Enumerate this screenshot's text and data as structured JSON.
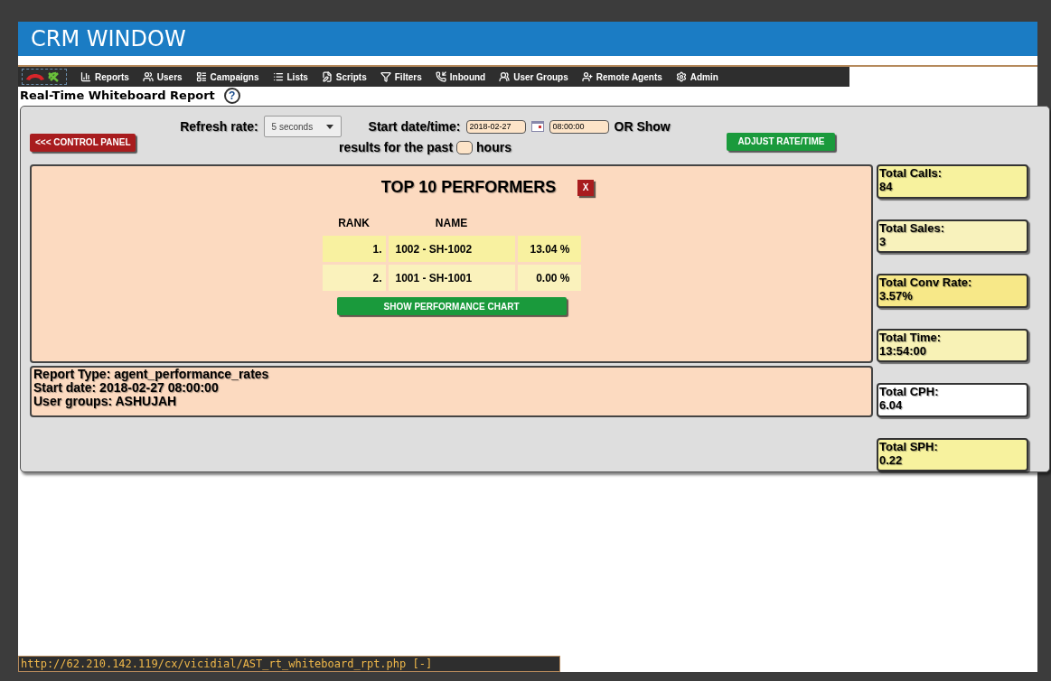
{
  "window": {
    "title": "CRM WINDOW"
  },
  "nav": [
    {
      "label": "Reports",
      "kind": "reports"
    },
    {
      "label": "Users",
      "kind": "users"
    },
    {
      "label": "Campaigns",
      "kind": "campaigns"
    },
    {
      "label": "Lists",
      "kind": "lists"
    },
    {
      "label": "Scripts",
      "kind": "scripts"
    },
    {
      "label": "Filters",
      "kind": "filters"
    },
    {
      "label": "Inbound",
      "kind": "inbound"
    },
    {
      "label": "User Groups",
      "kind": "groups"
    },
    {
      "label": "Remote Agents",
      "kind": "remote"
    },
    {
      "label": "Admin",
      "kind": "admin"
    }
  ],
  "page_title": "Real-Time Whiteboard Report",
  "help": "?",
  "controls": {
    "back_button": "<<< CONTROL PANEL",
    "refresh_label": "Refresh rate:",
    "refresh_value": "5 seconds",
    "start_label": "Start date/time:",
    "start_date": "2018-02-27",
    "start_time": "08:00:00",
    "or_show": "OR Show",
    "past_label": "results for the past",
    "hours_label": "hours",
    "adjust_button": "ADJUST RATE/TIME"
  },
  "performers": {
    "title": "TOP 10 PERFORMERS",
    "close": "X",
    "columns": [
      "RANK",
      "NAME"
    ],
    "rows": [
      {
        "rank": "1.",
        "name": "1002 - SH-1002",
        "rate": "13.04 %"
      },
      {
        "rank": "2.",
        "name": "1001 - SH-1001",
        "rate": "0.00 %"
      }
    ],
    "chart_button": "SHOW PERFORMANCE CHART"
  },
  "report_info": [
    "Report Type: agent_performance_rates",
    "Start date: 2018-02-27 08:00:00",
    "User groups: ASHUJAH"
  ],
  "stats": [
    {
      "label": "Total Calls:",
      "value": "84",
      "color": "#f7f29e"
    },
    {
      "label": "Total Sales:",
      "value": "3",
      "color": "#f8f2bc"
    },
    {
      "label": "Total Conv Rate:",
      "value": "3.57%",
      "color": "#f7e888"
    },
    {
      "label": "Total Time:",
      "value": "13:54:00",
      "color": "#f8f2b6"
    },
    {
      "label": "Total CPH:",
      "value": "6.04",
      "color": "#ffffff"
    },
    {
      "label": "Total SPH:",
      "value": "0.22",
      "color": "#f7f29e"
    }
  ],
  "status_bar": "http://62.210.142.119/cx/vicidial/AST_rt_whiteboard_rpt.php [-]"
}
